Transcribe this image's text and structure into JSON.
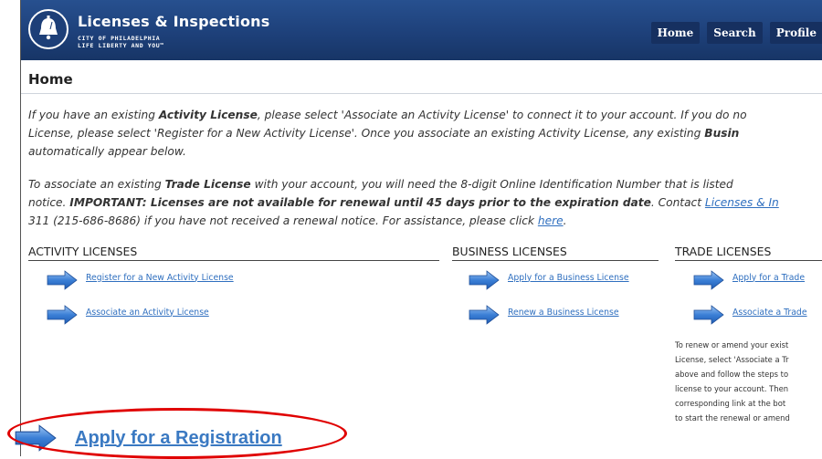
{
  "header": {
    "app_title": "Licenses & Inspections",
    "city_line1": "CITY OF PHILADELPHIA",
    "city_line2": "LIFE LIBERTY AND YOU™",
    "nav": [
      "Home",
      "Search",
      "Profile"
    ]
  },
  "page_title": "Home",
  "intro": {
    "p1_a": "If you have an existing ",
    "p1_b": "Activity License",
    "p1_c": ", please select 'Associate an Activity License' to connect it to your account. If you do no",
    "p1_d": "License, please select 'Register for a New Activity License'. Once you associate an existing Activity License, any existing ",
    "p1_e": "Busin",
    "p1_f": "automatically appear below.",
    "p2_a": "To associate an existing ",
    "p2_b": "Trade License",
    "p2_c": " with your account, you will need the 8-digit Online Identification Number that is listed",
    "p2_d": "notice. ",
    "p2_e": "IMPORTANT: Licenses are not available for renewal until 45 days prior to the expiration date",
    "p2_f": ". Contact ",
    "p2_g": "Licenses & In",
    "p2_h": "311 (215-686-8686) if you have not received a renewal notice. For assistance, please click ",
    "p2_i": "here",
    "p2_j": "."
  },
  "columns": {
    "activity": {
      "heading": "ACTIVITY LICENSES",
      "links": [
        "Register for a New Activity License",
        "Associate an Activity License"
      ]
    },
    "business": {
      "heading": "BUSINESS LICENSES",
      "links": [
        "Apply for a Business License",
        "Renew a Business License"
      ]
    },
    "trade": {
      "heading": "TRADE LICENSES",
      "links": [
        "Apply for a Trade",
        "Associate a Trade"
      ],
      "note": [
        "To renew or amend your exist",
        "License, select 'Associate a Tr",
        "above and follow the steps to",
        "license to your account. Then",
        "corresponding link at the bot",
        "to start the renewal or amend"
      ]
    }
  },
  "registration_link": "Apply for a Registration",
  "colors": {
    "header_blue": "#1d3f78",
    "link_blue": "#2f6fbf",
    "highlight_red": "#e00000"
  }
}
